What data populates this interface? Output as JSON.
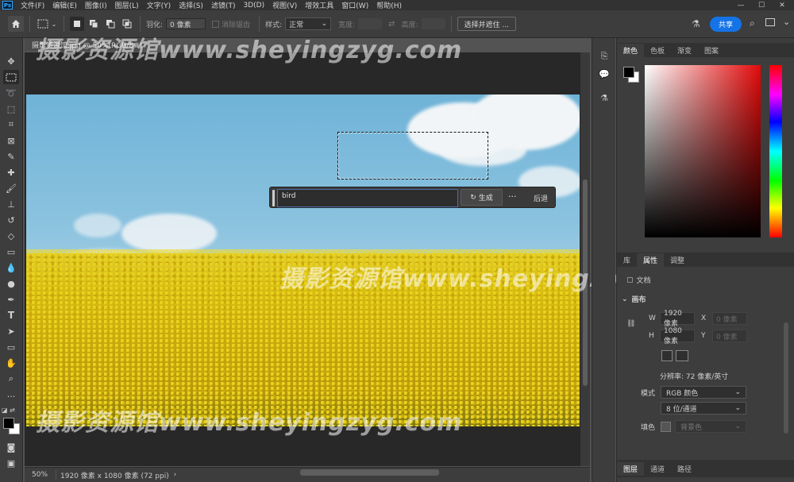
{
  "menubar": {
    "logo": "Ps",
    "items": [
      "文件(F)",
      "编辑(E)",
      "图像(I)",
      "图层(L)",
      "文字(Y)",
      "选择(S)",
      "滤镜(T)",
      "3D(D)",
      "视图(V)",
      "增效工具",
      "窗口(W)",
      "帮助(H)"
    ],
    "minimize": "—",
    "maximize": "☐",
    "close": "✕"
  },
  "options": {
    "feather_label": "羽化:",
    "feather_value": "0 像素",
    "antialias_label": "消除锯齿",
    "style_label": "样式:",
    "style_value": "正常",
    "width_label": "宽度:",
    "height_label": "高度:",
    "select_mask_label": "选择并遮住 ...",
    "share_label": "共享"
  },
  "document": {
    "tab_title": "摄影资源馆.jpg @ 50%(RGB/8#)",
    "zoom": "50%",
    "dimensions": "1920 像素 x 1080 像素 (72 ppi)"
  },
  "generative": {
    "prompt": "bird",
    "generate_label": "生成",
    "more_label": "···",
    "back_label": "后退"
  },
  "watermark": {
    "text": "摄影资源馆www.sheyingzyg.com"
  },
  "color_panel": {
    "tabs": [
      "颜色",
      "色板",
      "渐变",
      "图案"
    ],
    "fg_color": "#000000",
    "bg_color": "#ffffff"
  },
  "props_panel": {
    "tabs": [
      "库",
      "属性",
      "调整"
    ],
    "doc_label": "文档",
    "section_title": "画布",
    "w_label": "W",
    "w_value": "1920 像素",
    "h_label": "H",
    "h_value": "1080 像素",
    "x_label": "X",
    "x_value": "0 像素",
    "y_label": "Y",
    "y_value": "0 像素",
    "resolution": "分辨率: 72 像素/英寸",
    "mode_label": "模式",
    "mode_value": "RGB 颜色",
    "depth_value": "8 位/通道",
    "fill_label": "填色",
    "fill_value": "背景色"
  },
  "bottom_panel": {
    "tabs": [
      "图层",
      "通道",
      "路径"
    ]
  }
}
